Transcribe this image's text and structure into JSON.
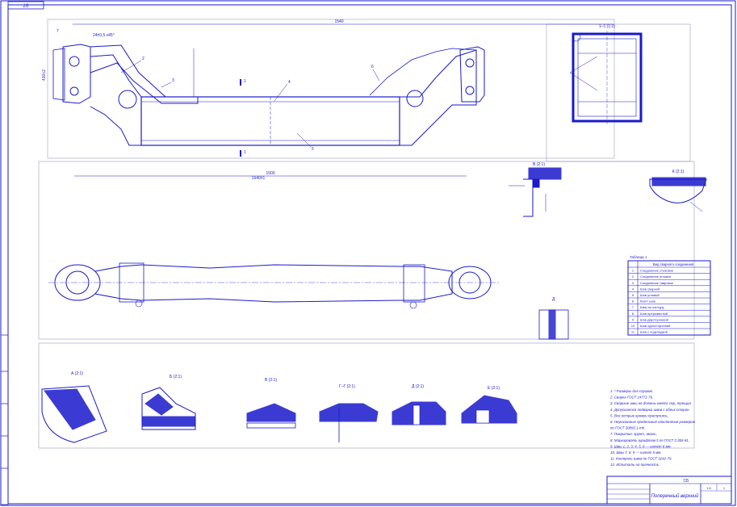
{
  "sheet": {
    "corner_stamp": "97",
    "format_label": "А1",
    "colors": {
      "line": "#1a1acc",
      "section_fill": "#1a1acc",
      "thin": "#8888bb",
      "paper": "#ffffff"
    }
  },
  "main_view": {
    "dim_top": "1540",
    "dim_mid": "1500",
    "dim_bottom": "1640±1",
    "dim_left": "410±2",
    "dim_weld": "24±0,5 x45°",
    "section_marks": [
      "1",
      "1"
    ],
    "callouts": [
      "2",
      "3",
      "4",
      "5",
      "6",
      "7"
    ]
  },
  "section_view": {
    "title": "1–1 (1:2)"
  },
  "detail_views": {
    "view_b_title": "В (2:1)",
    "view_k_title": "К (2:1)",
    "view_d_label": "Д"
  },
  "welds": {
    "titles": [
      "А (2:1)",
      "Б (2:1)",
      "В (2:1)",
      "Г–Г (2:1)",
      "Д (2:1)",
      "Е (2:1)"
    ]
  },
  "parts_table": {
    "caption": "Таблица 1",
    "header": "Вид сварного соединения",
    "rows": [
      {
        "n": "1",
        "text": "Соединение стыковое"
      },
      {
        "n": "2",
        "text": "Соединение угловое"
      },
      {
        "n": "3",
        "text": "Соединение тавровое"
      },
      {
        "n": "4",
        "text": "Шов сварной"
      },
      {
        "n": "5",
        "text": "Шов угловой"
      },
      {
        "n": "6",
        "text": "Катет шва"
      },
      {
        "n": "7",
        "text": "Швы по контуру"
      },
      {
        "n": "8",
        "text": "Шов прерывистый"
      },
      {
        "n": "9",
        "text": "Шов двусторонний"
      },
      {
        "n": "10",
        "text": "Шов односторонний"
      },
      {
        "n": "11",
        "text": "Шов с подкладкой"
      }
    ]
  },
  "notes": {
    "lines": [
      "1. * Размеры для справок.",
      "2. Сварка ГОСТ 14771-76.",
      "3. Сварные швы не должны иметь пор, трещин.",
      "4. Допускается подварка швов с обеих сторон.",
      "5. Все острые кромки притупить.",
      "6. Неуказанные предельные отклонения размеров",
      "   по ГОСТ 30893.1-mK.",
      "7. Покрытие: грунт, эмаль.",
      "8. Маркировать шрифтом 5 по ГОСТ 2.304-81.",
      "9. Швы 1, 2, 3, 4, 5, 6 — катет 6 мм.",
      "10. Швы 7, 8, 9 — катет 5 мм.",
      "11. Контроль швов по ГОСТ 3242-79.",
      "12. Испытать на прочность."
    ]
  },
  "title_block": {
    "name": "Поперечный верхний",
    "material_code": "СБ",
    "sheet_no": "1:5",
    "sheets_total": "1"
  }
}
